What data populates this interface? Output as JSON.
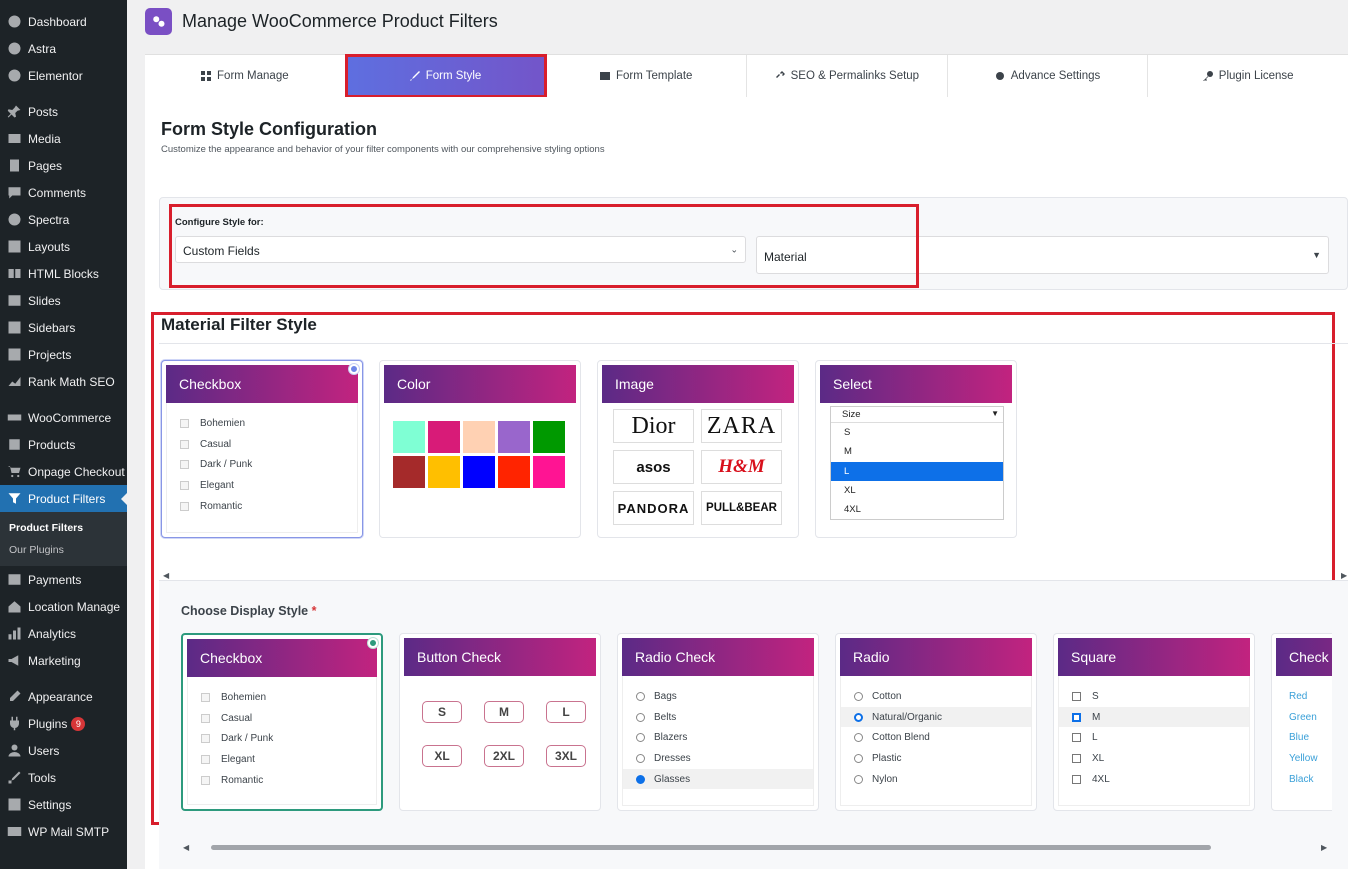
{
  "sidebar": {
    "items": [
      {
        "label": "Dashboard",
        "icon": "dashboard-icon"
      },
      {
        "label": "Astra",
        "icon": "astra-icon"
      },
      {
        "label": "Elementor",
        "icon": "elementor-icon"
      },
      {
        "label": "Posts",
        "icon": "pin-icon"
      },
      {
        "label": "Media",
        "icon": "media-icon"
      },
      {
        "label": "Pages",
        "icon": "pages-icon"
      },
      {
        "label": "Comments",
        "icon": "comments-icon"
      },
      {
        "label": "Spectra",
        "icon": "spectra-icon"
      },
      {
        "label": "Layouts",
        "icon": "layouts-icon"
      },
      {
        "label": "HTML Blocks",
        "icon": "html-blocks-icon"
      },
      {
        "label": "Slides",
        "icon": "slides-icon"
      },
      {
        "label": "Sidebars",
        "icon": "sidebars-icon"
      },
      {
        "label": "Projects",
        "icon": "projects-icon"
      },
      {
        "label": "Rank Math SEO",
        "icon": "rank-math-icon"
      },
      {
        "label": "WooCommerce",
        "icon": "woocommerce-icon"
      },
      {
        "label": "Products",
        "icon": "products-icon"
      },
      {
        "label": "Onpage Checkout",
        "icon": "cart-icon"
      },
      {
        "label": "Product Filters",
        "icon": "filter-icon"
      },
      {
        "label": "Payments",
        "icon": "payments-icon"
      },
      {
        "label": "Location Manage",
        "icon": "location-icon"
      },
      {
        "label": "Analytics",
        "icon": "analytics-icon"
      },
      {
        "label": "Marketing",
        "icon": "marketing-icon"
      },
      {
        "label": "Appearance",
        "icon": "appearance-icon"
      },
      {
        "label": "Plugins",
        "icon": "plugins-icon",
        "badge": "9"
      },
      {
        "label": "Users",
        "icon": "users-icon"
      },
      {
        "label": "Tools",
        "icon": "tools-icon"
      },
      {
        "label": "Settings",
        "icon": "settings-icon"
      },
      {
        "label": "WP Mail SMTP",
        "icon": "mail-icon"
      }
    ],
    "submenu": [
      "Product Filters",
      "Our Plugins"
    ]
  },
  "header": {
    "title": "Manage WooCommerce Product Filters"
  },
  "tabs": [
    {
      "label": "Form Manage",
      "icon": "grid-icon"
    },
    {
      "label": "Form Style",
      "icon": "brush-icon"
    },
    {
      "label": "Form Template",
      "icon": "template-icon"
    },
    {
      "label": "SEO & Permalinks Setup",
      "icon": "link-icon"
    },
    {
      "label": "Advance Settings",
      "icon": "gear-icon"
    },
    {
      "label": "Plugin License",
      "icon": "key-icon"
    }
  ],
  "config": {
    "heading": "Form Style Configuration",
    "description": "Customize the appearance and behavior of your filter components with our comprehensive styling options",
    "label": "Configure Style for:",
    "select1": "Custom Fields",
    "select2": "Material"
  },
  "filter_style": {
    "heading": "Material Filter Style",
    "cards": {
      "checkbox": {
        "title": "Checkbox",
        "items": [
          "Bohemien",
          "Casual",
          "Dark / Punk",
          "Elegant",
          "Romantic"
        ]
      },
      "color": {
        "title": "Color",
        "swatches": [
          "#7fffd4",
          "#d81b78",
          "#ffd1b3",
          "#9966cc",
          "#009900",
          "#a52a2a",
          "#ffbf00",
          "#0000ff",
          "#ff2400",
          "#ff1493"
        ]
      },
      "image": {
        "title": "Image",
        "logos": [
          "Dior",
          "ZARA",
          "asos",
          "H&M",
          "PANDORA",
          "PULL&BEAR"
        ]
      },
      "select": {
        "title": "Select",
        "placeholder": "Size",
        "options": [
          "S",
          "M",
          "L",
          "XL",
          "4XL"
        ],
        "selected": "L"
      }
    }
  },
  "display_style": {
    "label": "Choose Display Style",
    "required": "*",
    "cards": {
      "checkbox": {
        "title": "Checkbox",
        "items": [
          "Bohemien",
          "Casual",
          "Dark / Punk",
          "Elegant",
          "Romantic"
        ]
      },
      "button_check": {
        "title": "Button Check",
        "items": [
          "S",
          "M",
          "L",
          "XL",
          "2XL",
          "3XL"
        ]
      },
      "radio_check": {
        "title": "Radio Check",
        "items": [
          "Bags",
          "Belts",
          "Blazers",
          "Dresses",
          "Glasses"
        ]
      },
      "radio": {
        "title": "Radio",
        "items": [
          "Cotton",
          "Natural/Organic",
          "Cotton Blend",
          "Plastic",
          "Nylon"
        ]
      },
      "square": {
        "title": "Square",
        "items": [
          "S",
          "M",
          "L",
          "XL",
          "4XL"
        ]
      },
      "check_links": {
        "title": "Check",
        "items": [
          "Red",
          "Green",
          "Blue",
          "Yellow",
          "Black"
        ]
      }
    }
  },
  "colors": {
    "accent": "#2271b1",
    "highlight_red": "#d81e2c",
    "card_gradient_start": "#5b2a86",
    "card_gradient_end": "#c2237f"
  }
}
